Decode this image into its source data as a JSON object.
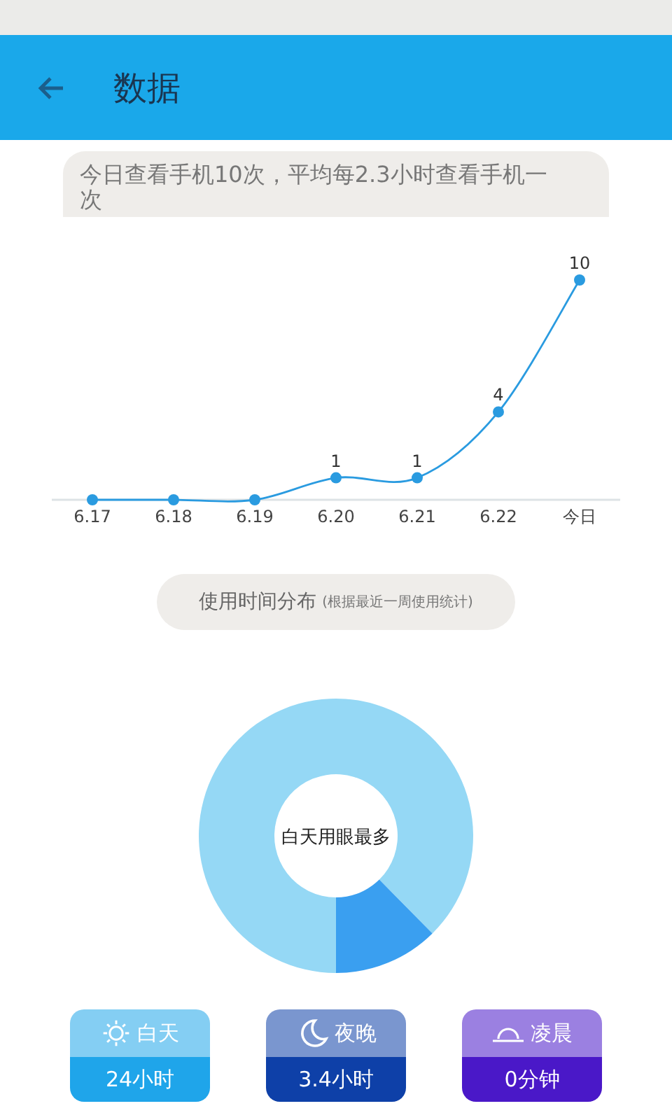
{
  "header": {
    "title": "数据"
  },
  "summary": "今日查看手机10次，平均每2.3小时查看手机一次",
  "trend": {
    "chart_data": {
      "type": "line",
      "categories": [
        "6.17",
        "6.18",
        "6.19",
        "6.20",
        "6.21",
        "6.22",
        "今日"
      ],
      "series": [
        {
          "color": "#2a9be0",
          "marker": true,
          "values": [
            0,
            0,
            0,
            1,
            1,
            4,
            10
          ],
          "value_labels": [
            null,
            null,
            null,
            "1",
            "1",
            "4",
            "10"
          ]
        }
      ]
    }
  },
  "distribution": {
    "title": "使用时间分布",
    "note": "(根据最近一周使用统计)",
    "center_label": "白天用眼最多",
    "chart_data": {
      "type": "donut",
      "series": [
        {
          "values": [
            87.6,
            12.4
          ]
        }
      ],
      "colors": [
        "#95d8f5",
        "#3a9ff0"
      ]
    }
  },
  "periods": [
    {
      "kind": "sun",
      "label": "白天",
      "value": "24小时",
      "color": "#1fa5ea"
    },
    {
      "kind": "moon",
      "label": "夜晚",
      "value": "3.4小时",
      "color": "#0e40a8"
    },
    {
      "kind": "dawn",
      "label": "凌晨",
      "value": "0分钟",
      "color": "#4a18c8"
    }
  ]
}
